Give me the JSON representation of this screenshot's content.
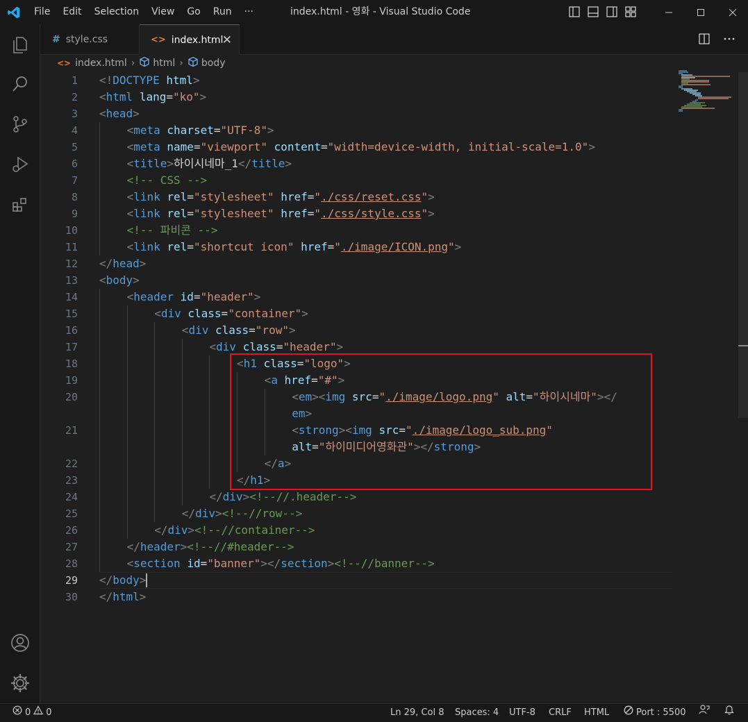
{
  "window": {
    "title": "index.html - 영화 - Visual Studio Code",
    "menu": [
      "File",
      "Edit",
      "Selection",
      "View",
      "Go",
      "Run"
    ],
    "menu_more": "···"
  },
  "tabs": [
    {
      "label": "style.css",
      "icon": "css-hash-icon",
      "active": false
    },
    {
      "label": "index.html",
      "icon": "html-brackets-icon",
      "active": true,
      "close": "✕"
    }
  ],
  "breadcrumb": [
    "index.html",
    "html",
    "body"
  ],
  "editor": {
    "lines": [
      {
        "n": "1",
        "indent": 0,
        "tokens": [
          [
            "br",
            "<!"
          ],
          [
            "tag",
            "DOCTYPE"
          ],
          [
            "txt",
            " "
          ],
          [
            "attr",
            "html"
          ],
          [
            "br",
            ">"
          ]
        ]
      },
      {
        "n": "2",
        "indent": 0,
        "tokens": [
          [
            "br",
            "<"
          ],
          [
            "tag",
            "html"
          ],
          [
            "txt",
            " "
          ],
          [
            "attr",
            "lang"
          ],
          [
            "txt",
            "="
          ],
          [
            "str",
            "\"ko\""
          ],
          [
            "br",
            ">"
          ]
        ]
      },
      {
        "n": "3",
        "indent": 0,
        "tokens": [
          [
            "br",
            "<"
          ],
          [
            "tag",
            "head"
          ],
          [
            "br",
            ">"
          ]
        ]
      },
      {
        "n": "4",
        "indent": 1,
        "tokens": [
          [
            "br",
            "<"
          ],
          [
            "tag",
            "meta"
          ],
          [
            "txt",
            " "
          ],
          [
            "attr",
            "charset"
          ],
          [
            "txt",
            "="
          ],
          [
            "str",
            "\"UTF-8\""
          ],
          [
            "br",
            ">"
          ]
        ]
      },
      {
        "n": "5",
        "indent": 1,
        "tokens": [
          [
            "br",
            "<"
          ],
          [
            "tag",
            "meta"
          ],
          [
            "txt",
            " "
          ],
          [
            "attr",
            "name"
          ],
          [
            "txt",
            "="
          ],
          [
            "str",
            "\"viewport\""
          ],
          [
            "txt",
            " "
          ],
          [
            "attr",
            "content"
          ],
          [
            "txt",
            "="
          ],
          [
            "str",
            "\"width=device-width, initial-scale=1.0\""
          ],
          [
            "br",
            ">"
          ]
        ]
      },
      {
        "n": "6",
        "indent": 1,
        "tokens": [
          [
            "br",
            "<"
          ],
          [
            "tag",
            "title"
          ],
          [
            "br",
            ">"
          ],
          [
            "txt",
            "하이시네마_1"
          ],
          [
            "br",
            "</"
          ],
          [
            "tag",
            "title"
          ],
          [
            "br",
            ">"
          ]
        ]
      },
      {
        "n": "7",
        "indent": 1,
        "tokens": [
          [
            "com",
            "<!-- CSS -->"
          ]
        ]
      },
      {
        "n": "8",
        "indent": 1,
        "tokens": [
          [
            "br",
            "<"
          ],
          [
            "tag",
            "link"
          ],
          [
            "txt",
            " "
          ],
          [
            "attr",
            "rel"
          ],
          [
            "txt",
            "="
          ],
          [
            "str",
            "\"stylesheet\""
          ],
          [
            "txt",
            " "
          ],
          [
            "attr",
            "href"
          ],
          [
            "txt",
            "="
          ],
          [
            "str",
            "\""
          ],
          [
            "ustr",
            "./css/reset.css"
          ],
          [
            "str",
            "\""
          ],
          [
            "br",
            ">"
          ]
        ]
      },
      {
        "n": "9",
        "indent": 1,
        "tokens": [
          [
            "br",
            "<"
          ],
          [
            "tag",
            "link"
          ],
          [
            "txt",
            " "
          ],
          [
            "attr",
            "rel"
          ],
          [
            "txt",
            "="
          ],
          [
            "str",
            "\"stylesheet\""
          ],
          [
            "txt",
            " "
          ],
          [
            "attr",
            "href"
          ],
          [
            "txt",
            "="
          ],
          [
            "str",
            "\""
          ],
          [
            "ustr",
            "./css/style.css"
          ],
          [
            "str",
            "\""
          ],
          [
            "br",
            ">"
          ]
        ]
      },
      {
        "n": "10",
        "indent": 1,
        "tokens": [
          [
            "com",
            "<!-- 파비콘 -->"
          ]
        ]
      },
      {
        "n": "11",
        "indent": 1,
        "tokens": [
          [
            "br",
            "<"
          ],
          [
            "tag",
            "link"
          ],
          [
            "txt",
            " "
          ],
          [
            "attr",
            "rel"
          ],
          [
            "txt",
            "="
          ],
          [
            "str",
            "\"shortcut icon\""
          ],
          [
            "txt",
            " "
          ],
          [
            "attr",
            "href"
          ],
          [
            "txt",
            "="
          ],
          [
            "str",
            "\""
          ],
          [
            "ustr",
            "./image/ICON.png"
          ],
          [
            "str",
            "\""
          ],
          [
            "br",
            ">"
          ]
        ]
      },
      {
        "n": "12",
        "indent": 0,
        "tokens": [
          [
            "br",
            "</"
          ],
          [
            "tag",
            "head"
          ],
          [
            "br",
            ">"
          ]
        ]
      },
      {
        "n": "13",
        "indent": 0,
        "tokens": [
          [
            "br",
            "<"
          ],
          [
            "tag",
            "body"
          ],
          [
            "br",
            ">"
          ]
        ]
      },
      {
        "n": "14",
        "indent": 1,
        "tokens": [
          [
            "br",
            "<"
          ],
          [
            "tag",
            "header"
          ],
          [
            "txt",
            " "
          ],
          [
            "attr",
            "id"
          ],
          [
            "txt",
            "="
          ],
          [
            "str",
            "\"header\""
          ],
          [
            "br",
            ">"
          ]
        ]
      },
      {
        "n": "15",
        "indent": 2,
        "tokens": [
          [
            "br",
            "<"
          ],
          [
            "tag",
            "div"
          ],
          [
            "txt",
            " "
          ],
          [
            "attr",
            "class"
          ],
          [
            "txt",
            "="
          ],
          [
            "str",
            "\"container\""
          ],
          [
            "br",
            ">"
          ]
        ]
      },
      {
        "n": "16",
        "indent": 3,
        "tokens": [
          [
            "br",
            "<"
          ],
          [
            "tag",
            "div"
          ],
          [
            "txt",
            " "
          ],
          [
            "attr",
            "class"
          ],
          [
            "txt",
            "="
          ],
          [
            "str",
            "\"row\""
          ],
          [
            "br",
            ">"
          ]
        ]
      },
      {
        "n": "17",
        "indent": 4,
        "tokens": [
          [
            "br",
            "<"
          ],
          [
            "tag",
            "div"
          ],
          [
            "txt",
            " "
          ],
          [
            "attr",
            "class"
          ],
          [
            "txt",
            "="
          ],
          [
            "str",
            "\"header\""
          ],
          [
            "br",
            ">"
          ]
        ]
      },
      {
        "n": "18",
        "indent": 5,
        "tokens": [
          [
            "br",
            "<"
          ],
          [
            "tag",
            "h1"
          ],
          [
            "txt",
            " "
          ],
          [
            "attr",
            "class"
          ],
          [
            "txt",
            "="
          ],
          [
            "str",
            "\"logo\""
          ],
          [
            "br",
            ">"
          ]
        ]
      },
      {
        "n": "19",
        "indent": 6,
        "tokens": [
          [
            "br",
            "<"
          ],
          [
            "tag",
            "a"
          ],
          [
            "txt",
            " "
          ],
          [
            "attr",
            "href"
          ],
          [
            "txt",
            "="
          ],
          [
            "str",
            "\"#\""
          ],
          [
            "br",
            ">"
          ]
        ]
      },
      {
        "n": "20",
        "indent": 7,
        "tokens": [
          [
            "br",
            "<"
          ],
          [
            "tag",
            "em"
          ],
          [
            "br",
            "><"
          ],
          [
            "tag",
            "img"
          ],
          [
            "txt",
            " "
          ],
          [
            "attr",
            "src"
          ],
          [
            "txt",
            "="
          ],
          [
            "str",
            "\""
          ],
          [
            "ustr",
            "./image/logo.png"
          ],
          [
            "str",
            "\""
          ],
          [
            "txt",
            " "
          ],
          [
            "attr",
            "alt"
          ],
          [
            "txt",
            "="
          ],
          [
            "str",
            "\"하이시네마\""
          ],
          [
            "br",
            "></"
          ]
        ]
      },
      {
        "n": "",
        "indent": 7,
        "tokens": [
          [
            "tag",
            "em"
          ],
          [
            "br",
            ">"
          ]
        ]
      },
      {
        "n": "21",
        "indent": 7,
        "tokens": [
          [
            "br",
            "<"
          ],
          [
            "tag",
            "strong"
          ],
          [
            "br",
            "><"
          ],
          [
            "tag",
            "img"
          ],
          [
            "txt",
            " "
          ],
          [
            "attr",
            "src"
          ],
          [
            "txt",
            "="
          ],
          [
            "str",
            "\""
          ],
          [
            "ustr",
            "./image/logo_sub.png"
          ],
          [
            "str",
            "\""
          ]
        ]
      },
      {
        "n": "",
        "indent": 7,
        "tokens": [
          [
            "attr",
            "alt"
          ],
          [
            "txt",
            "="
          ],
          [
            "str",
            "\"하이미디어영화관\""
          ],
          [
            "br",
            "></"
          ],
          [
            "tag",
            "strong"
          ],
          [
            "br",
            ">"
          ]
        ]
      },
      {
        "n": "22",
        "indent": 6,
        "tokens": [
          [
            "br",
            "</"
          ],
          [
            "tag",
            "a"
          ],
          [
            "br",
            ">"
          ]
        ]
      },
      {
        "n": "23",
        "indent": 5,
        "tokens": [
          [
            "br",
            "</"
          ],
          [
            "tag",
            "h1"
          ],
          [
            "br",
            ">"
          ]
        ]
      },
      {
        "n": "24",
        "indent": 4,
        "tokens": [
          [
            "br",
            "</"
          ],
          [
            "tag",
            "div"
          ],
          [
            "br",
            ">"
          ],
          [
            "com",
            "<!--//.header-->"
          ]
        ]
      },
      {
        "n": "25",
        "indent": 3,
        "tokens": [
          [
            "br",
            "</"
          ],
          [
            "tag",
            "div"
          ],
          [
            "br",
            ">"
          ],
          [
            "com",
            "<!--//row-->"
          ]
        ]
      },
      {
        "n": "26",
        "indent": 2,
        "tokens": [
          [
            "br",
            "</"
          ],
          [
            "tag",
            "div"
          ],
          [
            "br",
            ">"
          ],
          [
            "com",
            "<!--//container-->"
          ]
        ]
      },
      {
        "n": "27",
        "indent": 1,
        "tokens": [
          [
            "br",
            "</"
          ],
          [
            "tag",
            "header"
          ],
          [
            "br",
            ">"
          ],
          [
            "com",
            "<!--//#header-->"
          ]
        ]
      },
      {
        "n": "28",
        "indent": 1,
        "tokens": [
          [
            "br",
            "<"
          ],
          [
            "tag",
            "section"
          ],
          [
            "txt",
            " "
          ],
          [
            "attr",
            "id"
          ],
          [
            "txt",
            "="
          ],
          [
            "str",
            "\"banner\""
          ],
          [
            "br",
            "></"
          ],
          [
            "tag",
            "section"
          ],
          [
            "br",
            ">"
          ],
          [
            "com",
            "<!--//banner-->"
          ]
        ]
      },
      {
        "n": "29",
        "indent": 0,
        "tokens": [
          [
            "br",
            "</"
          ],
          [
            "tag",
            "body"
          ],
          [
            "br",
            ">"
          ]
        ],
        "current": true
      },
      {
        "n": "30",
        "indent": 0,
        "tokens": [
          [
            "br",
            "</"
          ],
          [
            "tag",
            "html"
          ],
          [
            "br",
            ">"
          ]
        ]
      }
    ]
  },
  "statusbar": {
    "errors": "0",
    "warnings": "0",
    "position": "Ln 29, Col 8",
    "spaces": "Spaces: 4",
    "encoding": "UTF-8",
    "eol": "CRLF",
    "language": "HTML",
    "port": "Port : 5500"
  },
  "colors": {
    "accent": "#0078d4",
    "highlight_box": "#e81123",
    "tag": "#569cd6",
    "attr": "#9cdcfe",
    "string": "#ce9178",
    "comment": "#6a9955"
  }
}
